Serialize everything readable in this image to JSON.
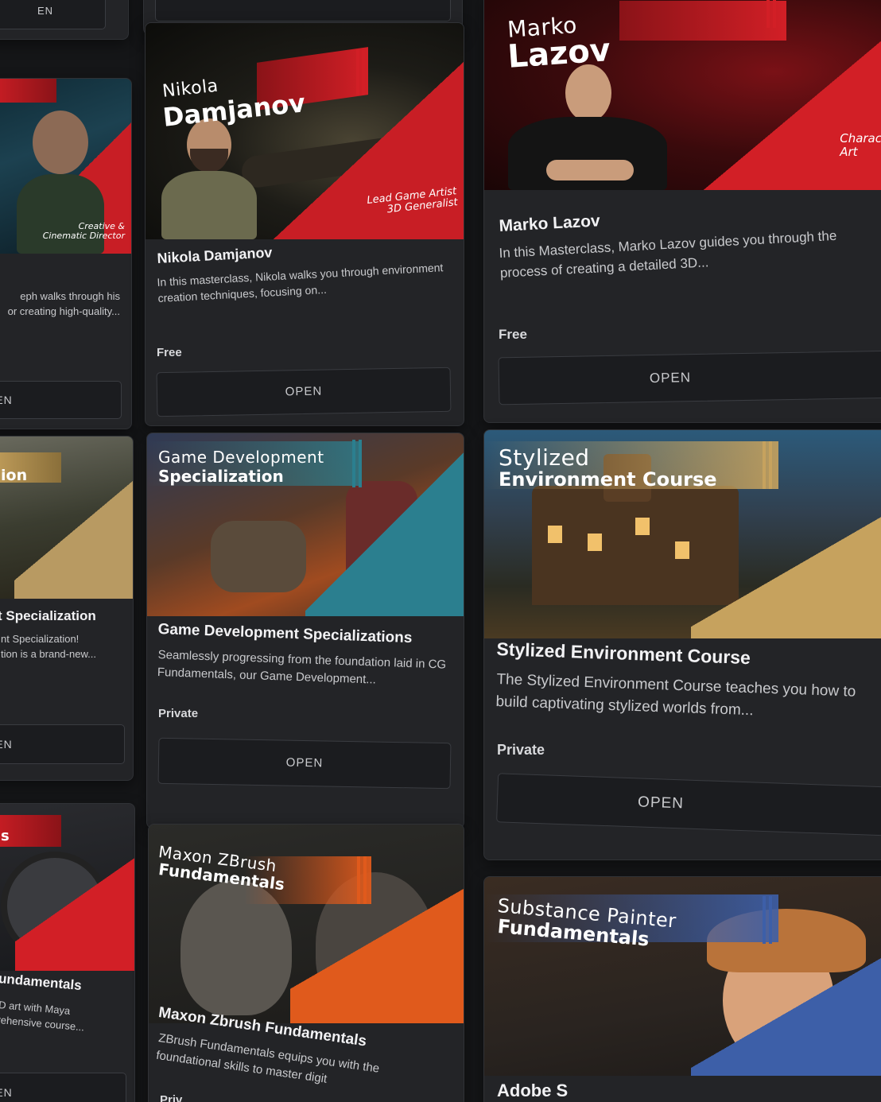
{
  "courses": [
    {
      "id": "left-top-partial",
      "thumb_subtitle": "Creative &\nCinematic Director",
      "desc": "eph walks through his\nor creating high-quality...",
      "open": "PEN"
    },
    {
      "id": "nikola",
      "thumb_line1": "Nikola",
      "thumb_line2": "Damjanov",
      "thumb_subtitle": "Lead Game Artist\n3D Generalist",
      "title": "Nikola Damjanov",
      "desc": "In this masterclass, Nikola walks you through environment creation techniques, focusing on...",
      "price": "Free",
      "open": "OPEN"
    },
    {
      "id": "marko",
      "thumb_line1": "Marko",
      "thumb_line2": "Lazov",
      "thumb_subtitle": "Charac\nArt",
      "title": "Marko Lazov",
      "desc": "In this Masterclass, Marko Lazov guides you through the process of creating a detailed 3D...",
      "price": "Free",
      "open": "OPEN"
    },
    {
      "id": "left-mid-partial",
      "thumb_line2": "ion",
      "title": "t Specialization",
      "desc": "nt Specialization!\ntion is a brand-new...",
      "open": "PEN"
    },
    {
      "id": "gamedev",
      "thumb_line1": "Game Development",
      "thumb_line2": "Specialization",
      "title": "Game Development Specializations",
      "desc": "Seamlessly progressing from the foundation laid in CG Fundamentals, our Game Development...",
      "price": "Private",
      "open": "OPEN"
    },
    {
      "id": "stylized",
      "thumb_line1": "Stylized",
      "thumb_line2": "Environment Course",
      "title": "Stylized Environment Course",
      "desc": "The Stylized Environment Course teaches you how to build captivating stylized worlds from...",
      "price": "Private",
      "open": "OPEN"
    },
    {
      "id": "left-bottom-partial",
      "thumb_line2": "s",
      "title": "undamentals",
      "desc": "D art with Maya\nrehensive course...",
      "open": "PEN"
    },
    {
      "id": "zbrush",
      "thumb_line1": "Maxon ZBrush",
      "thumb_line2": "Fundamentals",
      "title": "Maxon Zbrush Fundamentals",
      "desc": "ZBrush Fundamentals equips you with the foundational skills to master digit",
      "price": "Priv"
    },
    {
      "id": "substance",
      "thumb_line1": "Substance Painter",
      "thumb_line2": "Fundamentals",
      "title": "Adobe S"
    },
    {
      "id": "top-left-stub",
      "open": "EN"
    }
  ],
  "colors": {
    "page_bg": "#151618",
    "card_bg": "#232427",
    "red_accent": "#d21f26",
    "teal_accent": "#2b7f8f",
    "gold_accent": "#c6a25e",
    "orange_accent": "#e05a1c",
    "blue_accent": "#3d5fa8"
  }
}
